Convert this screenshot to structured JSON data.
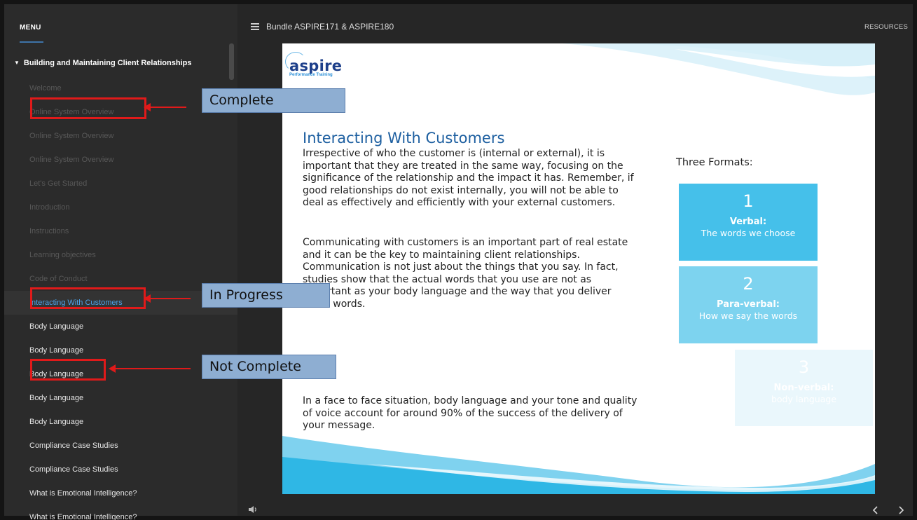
{
  "sidebar": {
    "menu_title": "MENU",
    "section_title": "Building and Maintaining Client Relationships",
    "items": [
      {
        "label": "Welcome",
        "status": "complete"
      },
      {
        "label": "Online System Overview",
        "status": "complete"
      },
      {
        "label": "Online System Overview",
        "status": "complete"
      },
      {
        "label": "Online System Overview",
        "status": "complete"
      },
      {
        "label": "Let's Get Started",
        "status": "complete"
      },
      {
        "label": "Introduction",
        "status": "complete"
      },
      {
        "label": "Instructions",
        "status": "complete"
      },
      {
        "label": "Learning objectives",
        "status": "complete"
      },
      {
        "label": "Code of Conduct",
        "status": "complete"
      },
      {
        "label": "Interacting With Customers",
        "status": "current"
      },
      {
        "label": "Body Language",
        "status": "pending"
      },
      {
        "label": "Body Language",
        "status": "pending"
      },
      {
        "label": "Body Language",
        "status": "pending"
      },
      {
        "label": "Body Language",
        "status": "pending"
      },
      {
        "label": "Body Language",
        "status": "pending"
      },
      {
        "label": "Compliance Case Studies",
        "status": "pending"
      },
      {
        "label": "Compliance Case Studies",
        "status": "pending"
      },
      {
        "label": "What is Emotional Intelligence?",
        "status": "pending"
      },
      {
        "label": "What is Emotional Intelligence?",
        "status": "pending"
      }
    ]
  },
  "header": {
    "course_title": "Bundle ASPIRE171 & ASPIRE180",
    "resources_label": "RESOURCES"
  },
  "slide": {
    "logo_text": "aspire",
    "logo_subtext": "Performance Training",
    "title": "Interacting With Customers",
    "paragraph_1": "Irrespective of who the customer is (internal or external), it is important that they are treated in the same way, focusing on the significance of the relationship and the impact it has. Remember, if good relationships do not exist internally, you will not be able to deal as effectively and efficiently with your external customers.",
    "paragraph_2": "Communicating with customers is an important part of real estate and it can be the key to maintaining client relationships. Communication is not just about the things that you say. In fact, studies show that the actual words that you use are not as important as your body language and the way that you deliver those words.",
    "paragraph_3": "In a face to face situation, body language and your tone and quality of voice account for around 90% of the success of the delivery of your message.",
    "formats_label": "Three Formats:",
    "formats": [
      {
        "num": "1",
        "name": "Verbal:",
        "desc": "The words we choose",
        "color": "#45c0ea"
      },
      {
        "num": "2",
        "name": "Para-verbal:",
        "desc": "How we say the words",
        "color": "#7dd3ef"
      },
      {
        "num": "3",
        "name": "Non-verbal:",
        "desc": "body language",
        "color": "#eaf7fc"
      }
    ]
  },
  "annotations": {
    "complete": "Complete",
    "in_progress": "In Progress",
    "not_complete": "Not Complete"
  },
  "footer": {
    "volume_icon": "volume-icon",
    "prev_icon": "chevron-left-icon",
    "next_icon": "chevron-right-icon"
  },
  "colors": {
    "accent": "#4aa3ea",
    "annotation_red": "#e01a1a",
    "callout_fill": "#8eaed2"
  }
}
